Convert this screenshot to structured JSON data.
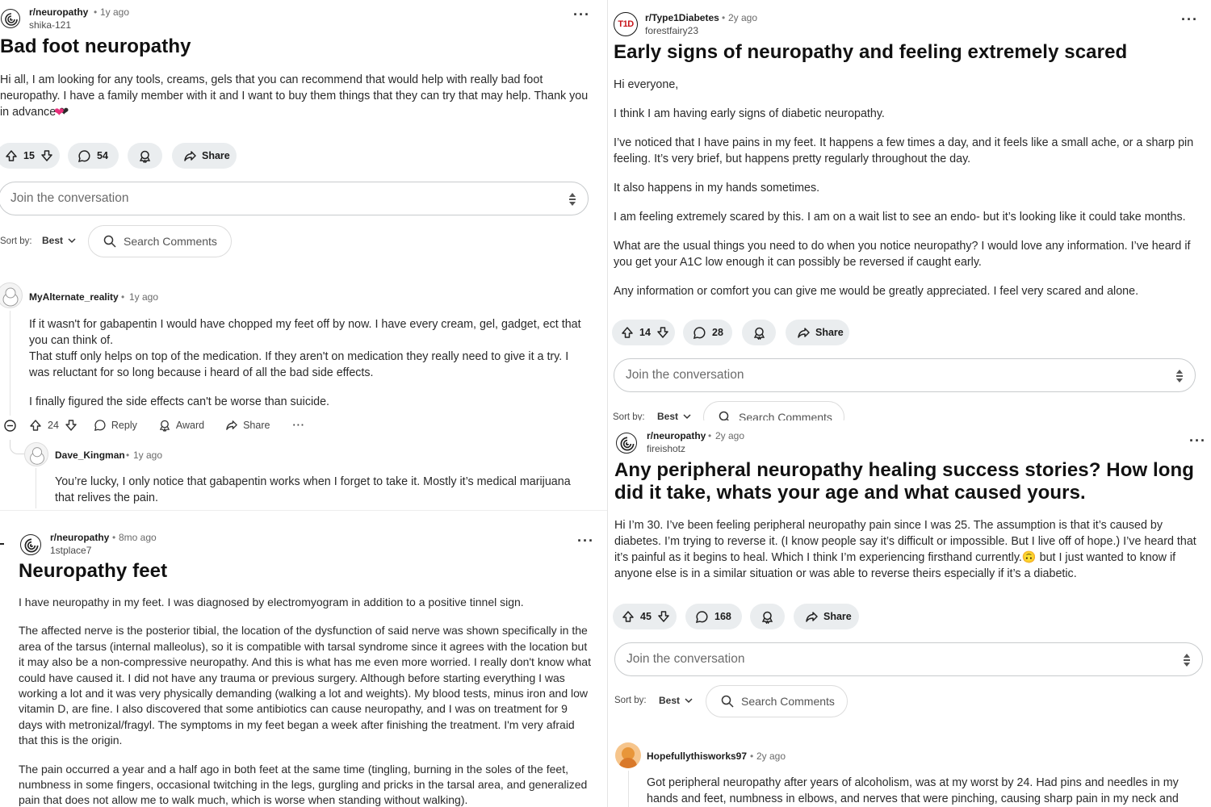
{
  "p1": {
    "subreddit": "r/neuropathy",
    "age": "1y ago",
    "user": "shika-121",
    "title": "Bad foot neuropathy",
    "body": [
      "Hi all, I am looking for any tools, creams, gels that you can recommend that would help with really bad foot",
      "neuropathy. I have a family member with it and I want to buy them things that they can try that may help. Thank you",
      "in advance ❤"
    ],
    "votes": "15",
    "comments": "54",
    "share": "Share",
    "join": "Join the conversation",
    "sortby": "Sort by:",
    "best": "Best",
    "search": "Search Comments",
    "c1": {
      "user": "MyAlternate_reality",
      "age": "1y ago",
      "lines": [
        "If it wasn't for gabapentin I would have chopped my feet off by now. I have every cream, gel, gadget, ect that",
        "you can think of.",
        "That stuff only helps on top of the medication. If they aren't on medication they really need to give it a try. I",
        "was reluctant for so long because i heard of all the bad side effects."
      ],
      "last": "I finally figured the side effects can't be worse than suicide.",
      "votes": "24",
      "reply": "Reply",
      "award": "Award",
      "share": "Share"
    },
    "c2": {
      "user": "Dave_Kingman",
      "age": "1y ago",
      "lines": [
        "You’re lucky, I only notice that gabapentin works when I forget to take it. Mostly it’s medical marijuana",
        "that relives the pain."
      ]
    }
  },
  "p2": {
    "subreddit": "r/Type1Diabetes",
    "age": "2y ago",
    "user": "forestfairy23",
    "avatar_text": "T1D",
    "title": "Early signs of neuropathy and feeling extremely scared",
    "paras": [
      "Hi everyone,",
      "I think I am having early signs of diabetic neuropathy.",
      "I’ve noticed that I have pains in my feet. It happens a few times a day, and it feels like a small ache, or a sharp pin feeling. It’s very brief, but happens pretty regularly throughout the day.",
      "It also happens in my hands sometimes.",
      "I am feeling extremely scared by this. I am on a wait list to see an endo- but it’s looking like it could take months.",
      "What are the usual things you need to do when you notice neuropathy? I would love any information. I’ve heard if you get your A1C low enough it can possibly be reversed if caught early.",
      "Any information or comfort you can give me would be greatly appreciated. I feel very scared and alone."
    ],
    "votes": "14",
    "comments": "28",
    "share": "Share",
    "join": "Join the conversation",
    "sortby": "Sort by:",
    "best": "Best",
    "search": "Search Comments"
  },
  "p3": {
    "subreddit": "r/neuropathy",
    "age": "8mo ago",
    "user": "1stplace7",
    "title": "Neuropathy feet",
    "paras": [
      "I have neuropathy in my feet. I was diagnosed by electromyogram in addition to a positive tinnel sign.",
      "The affected nerve is the posterior tibial, the location of the dysfunction of said nerve was shown specifically in the area of the tarsus (internal malleolus), so it is compatible with tarsal syndrome since it agrees with the location but it may also be a non-compressive neuropathy. And this is what has me even more worried. I really don't know what could have caused it. I did not have any trauma or previous surgery. Although before starting everything I was working a lot and it was very physically demanding (walking a lot and weights). My blood tests, minus iron and low vitamin D, are fine. I also discovered that some antibiotics can cause neuropathy, and I was on treatment for 9 days with metronizal/fragyl. The symptoms in my feet began a week after finishing the treatment. I'm very afraid that this is the origin.",
      "The pain occurred a year and a half ago in both feet at the same time (tingling, burning in the soles of the feet, numbness in some fingers, occasional twitching in the legs, gurgling and pricks in the tarsal area, and generalized pain that does not allow me to walk much, which is worse when standing without walking)."
    ]
  },
  "p4": {
    "subreddit": "r/neuropathy",
    "age": "2y ago",
    "user": "fireishotz",
    "title": "Any peripheral neuropathy healing success stories? How long did it take, whats your age and what caused yours.",
    "body": "Hi I’m 30. I’ve been feeling peripheral neuropathy pain since I was 25. The assumption is that it’s caused by diabetes. I’m trying to reverse it. (I know people say it’s difficult or impossible. But I live off of hope.) I’ve heard that it’s painful as it begins to heal. Which I think I’m experiencing firsthand currently.🙃 but I just wanted to know if anyone else is in a similar situation or was able to reverse theirs especially if it’s a diabetic.",
    "votes": "45",
    "comments": "168",
    "share": "Share",
    "join": "Join the conversation",
    "sortby": "Sort by:",
    "best": "Best",
    "search": "Search Comments",
    "c1": {
      "user": "Hopefullythisworks97",
      "age": "2y ago",
      "text": "Got peripheral neuropathy after years of alcoholism, was at my worst by 24. Had pins and needles in my hands and feet, numbness in elbows, and nerves that were pinching, causing sharp pain in my neck and arms. As I"
    }
  },
  "colors": {
    "heart": "#e8307c",
    "avatar_orange": "#e8963a",
    "t1d_red": "#c8151b"
  },
  "icons": [
    "neuropathy-sub-icon",
    "upvote-icon",
    "downvote-icon",
    "comment-icon",
    "award-icon",
    "share-icon",
    "search-icon",
    "sort-icon",
    "chevron-down-icon",
    "collapse-icon",
    "more-icon",
    "snoo-avatar-icon"
  ]
}
